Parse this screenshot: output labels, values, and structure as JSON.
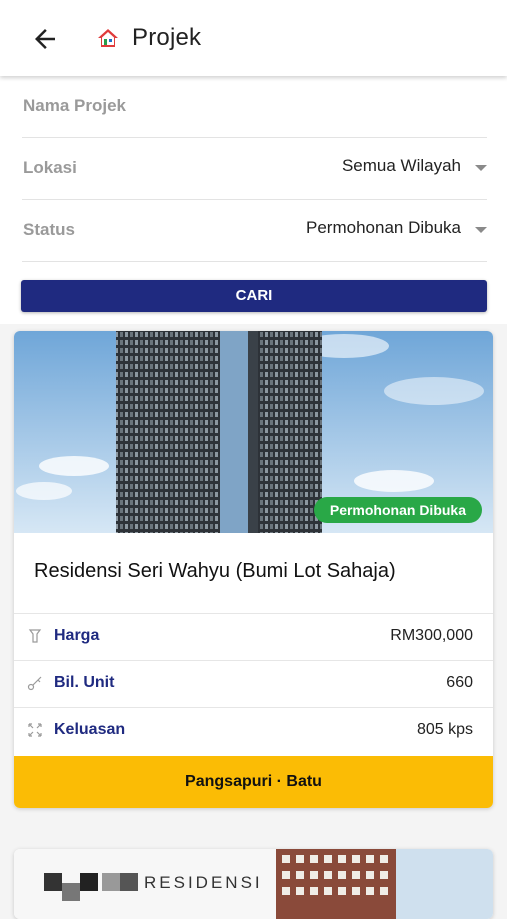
{
  "appbar": {
    "title": "Projek"
  },
  "filters": {
    "name": {
      "label": "Nama Projek"
    },
    "location": {
      "label": "Lokasi",
      "value": "Semua Wilayah"
    },
    "status": {
      "label": "Status",
      "value": "Permohonan Dibuka"
    }
  },
  "search_button": "CARI",
  "projects": [
    {
      "status_badge": "Permohonan Dibuka",
      "name": "Residensi Seri Wahyu (Bumi Lot Sahaja)",
      "details": [
        {
          "icon": "price-tag-icon",
          "label": "Harga",
          "value": "RM300,000"
        },
        {
          "icon": "key-icon",
          "label": "Bil. Unit",
          "value": "660"
        },
        {
          "icon": "expand-icon",
          "label": "Keluasan",
          "value": "805 kps"
        }
      ],
      "footer": "Pangsapuri · Batu"
    },
    {
      "image_text": "RESIDENSI"
    }
  ],
  "colors": {
    "primary": "#1f2a80",
    "accent": "#fbbc05",
    "badge": "#29a847"
  }
}
